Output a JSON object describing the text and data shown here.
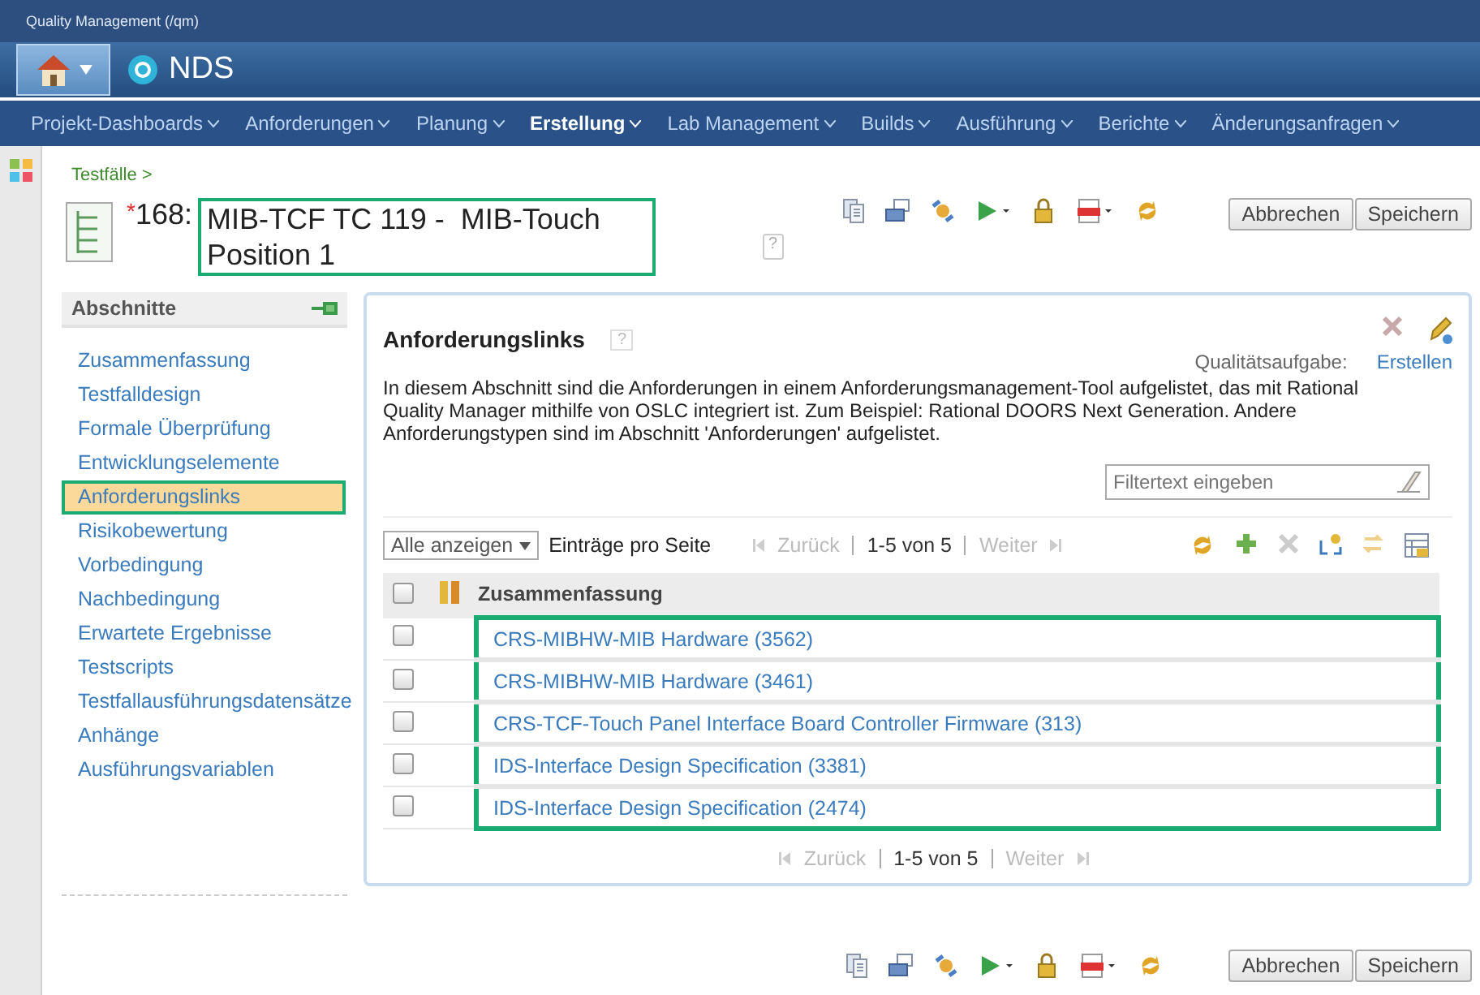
{
  "window": {
    "title": "Quality Management (/qm)"
  },
  "banner": {
    "title": "NDS"
  },
  "nav": [
    {
      "label": "Projekt-Dashboards",
      "selected": false
    },
    {
      "label": "Anforderungen",
      "selected": false
    },
    {
      "label": "Planung",
      "selected": false
    },
    {
      "label": "Erstellung",
      "selected": true
    },
    {
      "label": "Lab Management",
      "selected": false
    },
    {
      "label": "Builds",
      "selected": false
    },
    {
      "label": "Ausführung",
      "selected": false
    },
    {
      "label": "Berichte",
      "selected": false
    },
    {
      "label": "Änderungsanfragen",
      "selected": false
    }
  ],
  "breadcrumb": "Testfälle >",
  "header": {
    "modified_mark": "*",
    "id": "168:",
    "title": "MIB-TCF TC 119 -  MIB-Touch Position 1",
    "highlighted": true,
    "help": "?"
  },
  "actions": [
    {
      "label": "Abbrechen"
    },
    {
      "label": "Speichern"
    }
  ],
  "sidebar": {
    "title": "Abschnitte",
    "items": [
      {
        "label": "Zusammenfassung",
        "selected": false
      },
      {
        "label": "Testfalldesign",
        "selected": false
      },
      {
        "label": "Formale Überprüfung",
        "selected": false
      },
      {
        "label": "Entwicklungselemente",
        "selected": false
      },
      {
        "label": "Anforderungslinks",
        "selected": true
      },
      {
        "label": "Risikobewertung",
        "selected": false
      },
      {
        "label": "Vorbedingung",
        "selected": false
      },
      {
        "label": "Nachbedingung",
        "selected": false
      },
      {
        "label": "Erwartete Ergebnisse",
        "selected": false
      },
      {
        "label": "Testscripts",
        "selected": false
      },
      {
        "label": "Testfallausführungsdatensätze",
        "selected": false
      },
      {
        "label": "Anhänge",
        "selected": false
      },
      {
        "label": "Ausführungsvariablen",
        "selected": false
      }
    ]
  },
  "section": {
    "title": "Anforderungslinks",
    "help": "?",
    "task_label": "Qualitätsaufgabe:",
    "task_link": "Erstellen",
    "description": "In diesem Abschnitt sind die Anforderungen in einem Anforderungsmanagement-Tool aufgelistet, das mit Rational Quality Manager mithilfe von OSLC integriert ist. Zum Beispiel: Rational DOORS Next Generation. Andere Anforderungstypen sind im Abschnitt 'Anforderungen' aufgelistet.",
    "filter": {
      "placeholder": "Filtertext eingeben"
    },
    "page_size": "Alle anzeigen",
    "page_size_label": "Einträge pro Seite",
    "pager": {
      "prev": "Zurück",
      "prev_disabled": true,
      "range": "1-5 von 5",
      "next": "Weiter",
      "next_disabled": true
    },
    "table": {
      "header_checked": false,
      "columns": [
        "Zusammenfassung"
      ],
      "highlighted": true,
      "rows": [
        {
          "checked": false,
          "summary": "CRS-MIBHW-MIB Hardware (3562)"
        },
        {
          "checked": false,
          "summary": "CRS-MIBHW-MIB Hardware (3461)"
        },
        {
          "checked": false,
          "summary": "CRS-TCF-Touch Panel Interface Board Controller Firmware (313)"
        },
        {
          "checked": false,
          "summary": "IDS-Interface Design Specification (3381)"
        },
        {
          "checked": false,
          "summary": "IDS-Interface Design Specification (2474)"
        }
      ]
    },
    "bottom_pager": {
      "prev": "Zurück",
      "prev_disabled": true,
      "range": "1-5 von 5",
      "next": "Weiter",
      "next_disabled": true
    }
  },
  "footer_actions": [
    {
      "label": "Abbrechen"
    },
    {
      "label": "Speichern"
    }
  ]
}
